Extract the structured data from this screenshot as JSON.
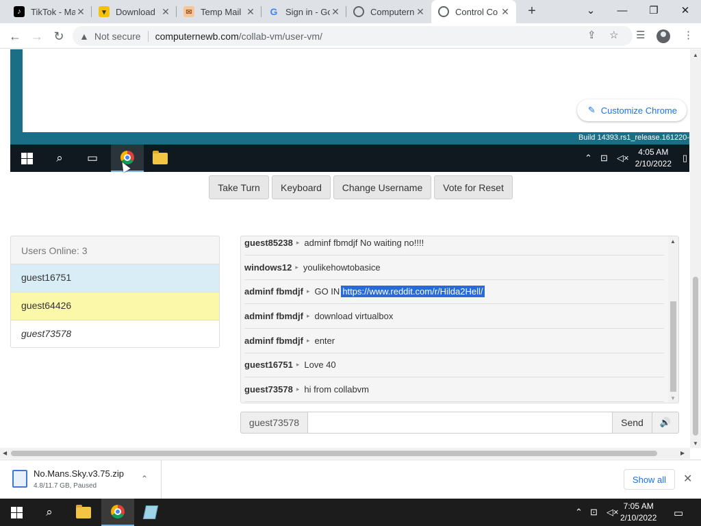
{
  "browser": {
    "tabs": [
      {
        "title": "TikTok - Ma",
        "icon": "tiktok-icon"
      },
      {
        "title": "Download",
        "icon": "download-site-icon"
      },
      {
        "title": "Temp Mail",
        "icon": "tempmail-icon"
      },
      {
        "title": "Sign in - Go",
        "icon": "google-icon"
      },
      {
        "title": "Computern",
        "icon": "computernewb-icon"
      },
      {
        "title": "Control Co",
        "icon": "computernewb-icon",
        "active": true
      }
    ],
    "address": {
      "security_label": "Not secure",
      "host": "computernewb.com",
      "path": "/collab-vm/user-vm/"
    }
  },
  "vm": {
    "customize_label": "Customize Chrome",
    "build_text": "Build 14393.rs1_release.161220-",
    "clock_time": "4:05 AM",
    "clock_date": "2/10/2022"
  },
  "controls": {
    "take_turn": "Take Turn",
    "keyboard": "Keyboard",
    "change_username": "Change Username",
    "vote_reset": "Vote for Reset"
  },
  "users": {
    "header": "Users Online: 3",
    "list": [
      "guest16751",
      "guest64426",
      "guest73578"
    ]
  },
  "chat": {
    "messages": [
      {
        "user": "guest85238",
        "text": "adminf fbmdjf No waiting no!!!!"
      },
      {
        "user": "windows12",
        "text": "youlikehowtobasice"
      },
      {
        "user": "adminf fbmdjf",
        "text": "GO IN",
        "link": "https://www.reddit.com/r/Hilda2Hell/"
      },
      {
        "user": "adminf fbmdjf",
        "text": "download virtualbox"
      },
      {
        "user": "adminf fbmdjf",
        "text": "enter"
      },
      {
        "user": "guest16751",
        "text": "Love 40"
      },
      {
        "user": "guest73578",
        "text": "hi from collabvm"
      }
    ],
    "username": "guest73578",
    "input_value": "",
    "send_label": "Send"
  },
  "download": {
    "filename": "No.Mans.Sky.v3.75.zip",
    "status": "4.8/11.7 GB, Paused",
    "show_all": "Show all"
  },
  "taskbar": {
    "clock_time": "7:05 AM",
    "clock_date": "2/10/2022"
  },
  "colors": {
    "vm_desktop": "#1a6e86",
    "user_highlight_blue": "#d9edf7",
    "user_highlight_yellow": "#fcf8aa",
    "selection": "#2a6ad4",
    "link_blue": "#1a73e8"
  }
}
